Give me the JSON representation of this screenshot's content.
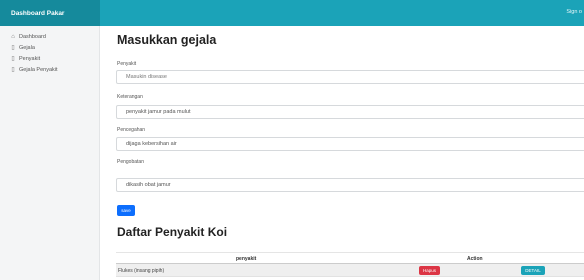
{
  "header": {
    "brand": "Dashboard Pakar",
    "signout": "Sign o"
  },
  "sidebar": {
    "items": [
      {
        "icon": "home-icon",
        "label": "Dashboard"
      },
      {
        "icon": "file-icon",
        "label": "Gejala"
      },
      {
        "icon": "file-icon",
        "label": "Penyakit"
      },
      {
        "icon": "file-icon",
        "label": "Gejala Penyakit"
      }
    ]
  },
  "form": {
    "title": "Masukkan gejala",
    "penyakit_label": "Penyakit",
    "penyakit_placeholder": "Masukin disease",
    "keterangan_label": "Keterangan",
    "keterangan_value": "penyakit jamur pada mulut",
    "pencegahan_label": "Pencegahan",
    "pencegahan_value": "dijaga kebersihan air",
    "pengobatan_label": "Pengobatan",
    "pengobatan_value": "dikasih obat jamur",
    "save_label": "save"
  },
  "table": {
    "title": "Daftar Penyakit Koi",
    "columns": [
      "penyakit",
      "Action"
    ],
    "rows": [
      {
        "name": "Flukes (insang pipih)",
        "delete_label": "Hapus",
        "detail_label": "DETAIL"
      }
    ]
  },
  "colors": {
    "accent": "#1ba3b8",
    "primary": "#0d6efd",
    "danger": "#dc3545"
  }
}
